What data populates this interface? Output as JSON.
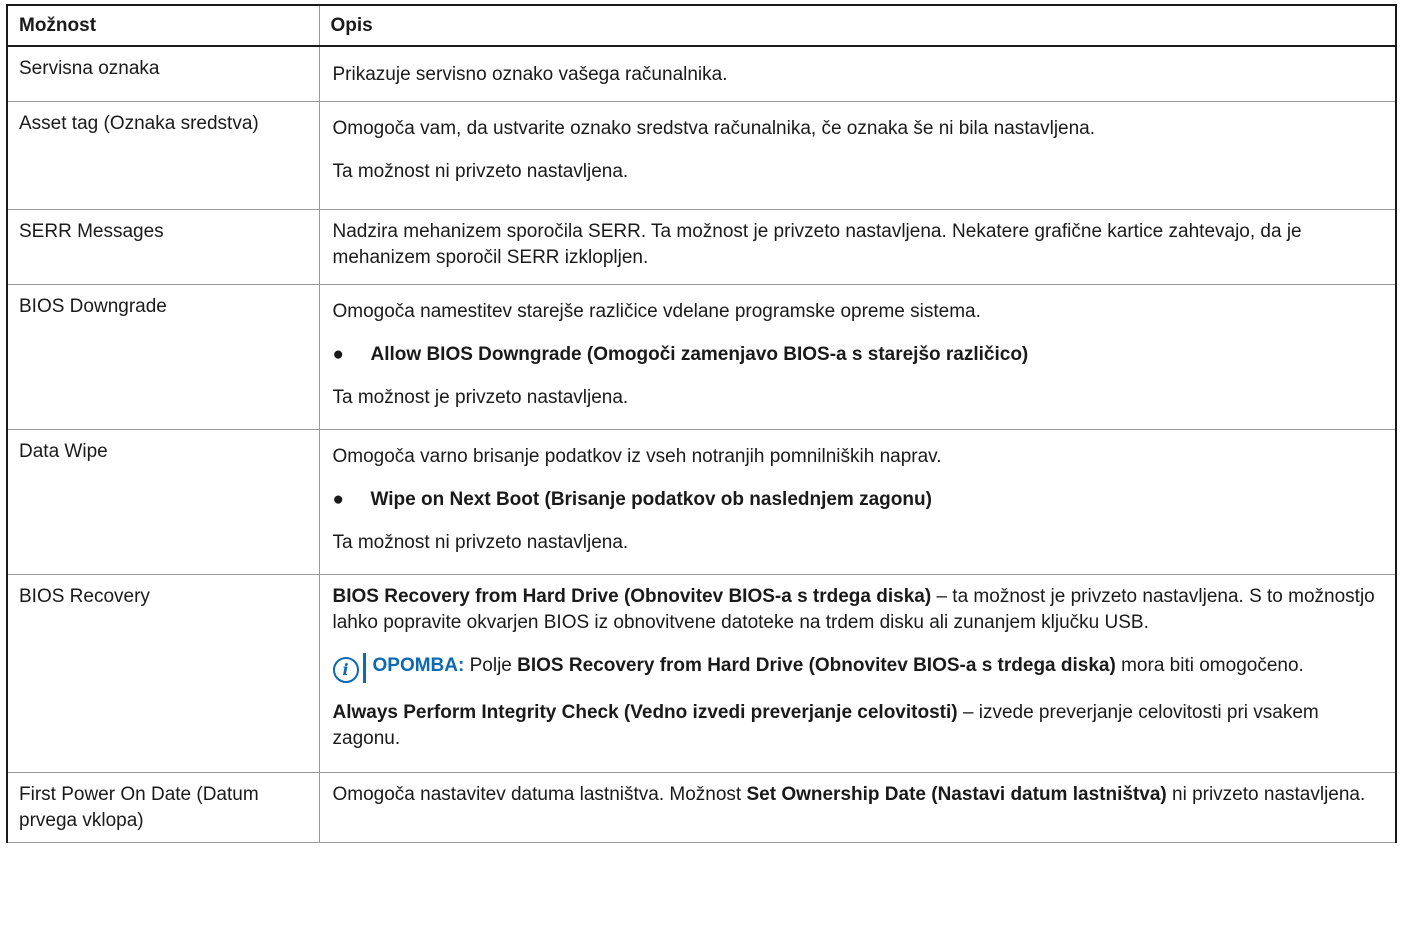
{
  "header": {
    "col1": "Možnost",
    "col2": "Opis"
  },
  "rows": {
    "r0": {
      "option": "Servisna oznaka",
      "p1": "Prikazuje servisno oznako vašega računalnika."
    },
    "r1": {
      "option": "Asset tag (Oznaka sredstva)",
      "p1": "Omogoča vam, da ustvarite oznako sredstva računalnika, če oznaka še ni bila nastavljena.",
      "p2": "Ta možnost ni privzeto nastavljena."
    },
    "r2": {
      "option": "SERR Messages",
      "p1": "Nadzira mehanizem sporočila SERR. Ta možnost je privzeto nastavljena. Nekatere grafične kartice zahtevajo, da je mehanizem sporočil SERR izklopljen."
    },
    "r3": {
      "option": "BIOS Downgrade",
      "p1": "Omogoča namestitev starejše različice vdelane programske opreme sistema.",
      "bullet": "Allow BIOS Downgrade (Omogoči zamenjavo BIOS-a s starejšo različico)",
      "p2": "Ta možnost je privzeto nastavljena."
    },
    "r4": {
      "option": "Data Wipe",
      "p1": "Omogoča varno brisanje podatkov iz vseh notranjih pomnilniških naprav.",
      "bullet": "Wipe on Next Boot (Brisanje podatkov ob naslednjem zagonu)",
      "p2": "Ta možnost ni privzeto nastavljena."
    },
    "r5": {
      "option": "BIOS Recovery",
      "p1_bold": "BIOS Recovery from Hard Drive (Obnovitev BIOS-a s trdega diska)",
      "p1_rest": " – ta možnost je privzeto nastavljena. S to možnostjo lahko popravite okvarjen BIOS iz obnovitvene datoteke na trdem disku ali zunanjem ključku USB.",
      "note_icon": "info-icon",
      "note_label": "OPOMBA:",
      "note_text1": " Polje ",
      "note_bold": "BIOS Recovery from Hard Drive (Obnovitev BIOS-a s trdega diska)",
      "note_text2": " mora biti omogočeno.",
      "p2_bold": "Always Perform Integrity Check (Vedno izvedi preverjanje celovitosti)",
      "p2_rest": " – izvede preverjanje celovitosti pri vsakem zagonu."
    },
    "r6": {
      "option": "First Power On Date (Datum prvega vklopa)",
      "p1_a": "Omogoča nastavitev datuma lastništva. Možnost ",
      "p1_bold": "Set Ownership Date (Nastavi datum lastništva)",
      "p1_b": " ni privzeto nastavljena."
    }
  },
  "colors": {
    "note_accent": "#0b6ab3",
    "border": "#9a9a9a"
  }
}
